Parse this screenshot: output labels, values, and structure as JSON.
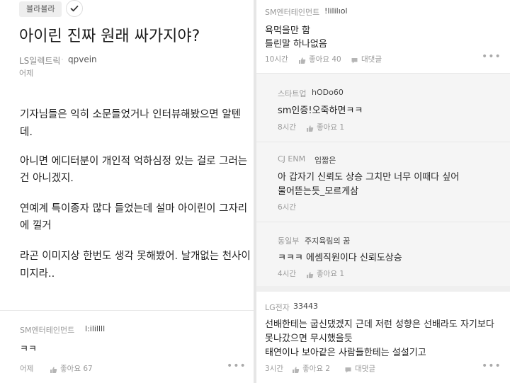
{
  "post": {
    "tag": "블라블라",
    "title": "아이린 진짜 원래 싸가지야?",
    "company": "LS일렉트릭",
    "separator": "·",
    "author": "qpvein",
    "time": "어제",
    "body_lines": [
      "기자님들은 익히 소문들었거나 인터뷰해봤으면 알텐",
      "데.",
      "아니면 에디터분이 개인적 억하심정 있는 걸로 그러는",
      "건 아니겠지.",
      "연예계 특이종자 많다 들었는데 설마 아이린이 그자리",
      "에 낄거",
      "라곤 이미지상 한번도 생각 못해봤어. 날개없는 천사이",
      "미지라.."
    ]
  },
  "left_comment": {
    "company": "SM엔터테인먼트",
    "author": "l:ilillll",
    "text": "ㅋㅋ",
    "time": "어제",
    "likes": "좋아요 67",
    "more": "•••"
  },
  "comments": [
    {
      "company": "SM엔터테인먼트",
      "author": "!lililıol",
      "lines": [
        "욕먹을만 함",
        "틀린말 하나없음"
      ],
      "time": "10시간",
      "likes": "좋아요 40",
      "reply": "대댓글",
      "more": "•••"
    },
    {
      "company": "스타트업",
      "author": "hODo60",
      "lines": [
        "sm인증!오죽하면ㅋㅋ"
      ],
      "time": "8시간",
      "likes": "좋아요 1"
    },
    {
      "company": "CJ ENM",
      "author": "입짧은",
      "lines": [
        "아 갑자기 신뢰도 상승 그치만 너무 이때다 싶어",
        "물어뜯는듯_모르게삼"
      ],
      "time": "6시간"
    },
    {
      "company": "동일부",
      "author": "주지육림의 꿈",
      "lines": [
        "ㅋㅋㅋ 에셈직원이다 신뢰도상승"
      ],
      "time": "4시간",
      "likes": "좋아요 1"
    },
    {
      "company": "LG전자",
      "author": "33443",
      "lines": [
        "선배한테는 굽신댔겠지 근데 저런 성향은 선배라도 자기보다",
        "못나갔으면 무시했을듯",
        "태연이나 보아같은 사람들한테는 설설기고"
      ],
      "time": "3시간",
      "likes": "좋아요 2",
      "reply": "대댓글",
      "more": "•••"
    }
  ],
  "icons": [
    "check-icon",
    "thumbs-up-icon",
    "comment-icon",
    "more-icon"
  ],
  "colors": {
    "background": "#ffffff",
    "divider": "#e6e6e6",
    "reply_bg": "#f5f5f5",
    "muted": "#999999",
    "text": "#222222"
  }
}
